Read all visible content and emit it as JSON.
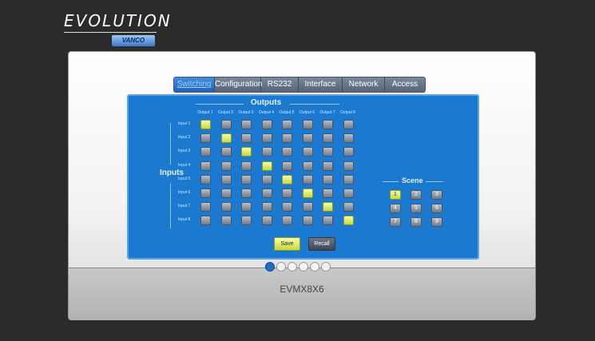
{
  "brand": {
    "name": "EVOLUTION",
    "sub": "VANCO"
  },
  "tabs": [
    "Switching",
    "Configuration",
    "RS232",
    "Interface",
    "Network",
    "Access"
  ],
  "active_tab": "Switching",
  "matrix": {
    "outputs_title": "Outputs",
    "inputs_title": "Inputs",
    "outputs": [
      "Output 1",
      "Output 2",
      "Output 3",
      "Output 4",
      "Output 5",
      "Output 6",
      "Output 7",
      "Output 8"
    ],
    "inputs": [
      "Input 1",
      "Input 2",
      "Input 3",
      "Input 4",
      "Input 5",
      "Input 6",
      "Input 7",
      "Input 8"
    ],
    "active_routes": [
      {
        "input": "Input 1",
        "output": "Output 1"
      },
      {
        "input": "Input 2",
        "output": "Output 2"
      },
      {
        "input": "Input 3",
        "output": "Output 3"
      },
      {
        "input": "Input 4",
        "output": "Output 4"
      },
      {
        "input": "Input 5",
        "output": "Output 5"
      },
      {
        "input": "Input 6",
        "output": "Output 6"
      },
      {
        "input": "Input 7",
        "output": "Output 7"
      },
      {
        "input": "Input 8",
        "output": "Output 8"
      }
    ]
  },
  "scene": {
    "title": "Scene",
    "buttons": [
      "1",
      "2",
      "3",
      "4",
      "5",
      "6",
      "7",
      "8",
      "9"
    ],
    "active": "1"
  },
  "actions": {
    "save": "Save",
    "recall": "Recall"
  },
  "pager": {
    "count": 6,
    "active": 1
  },
  "model": "EVMX8X6"
}
